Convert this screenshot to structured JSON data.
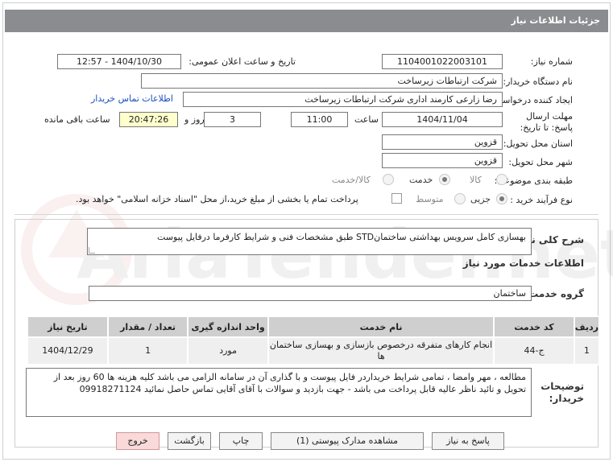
{
  "header": {
    "title": "جزئیات اطلاعات نیاز"
  },
  "fields": {
    "need_number_label": "شماره نیاز:",
    "need_number": "1104001022003101",
    "announce_label": "تاریخ و ساعت اعلان عمومی:",
    "announce_value": "1404/10/30 - 12:57",
    "buyer_org_label": "نام دستگاه خریدار:",
    "buyer_org": "شرکت ارتباطات زیرساخت",
    "requester_label": "ایجاد کننده درخواست:",
    "requester": "رضا زارعی کارمند اداری شرکت ارتباطات زیرساخت",
    "buyer_contact_link": "اطلاعات تماس خریدار",
    "deadline_label": "مهلت ارسال پاسخ: تا تاریخ:",
    "deadline_date": "1404/11/04",
    "time_label": "ساعت",
    "deadline_time": "11:00",
    "days_value": "3",
    "days_label": "روز و",
    "remaining_time": "20:47:26",
    "remaining_label": "ساعت باقی مانده",
    "province_label": "استان محل تحویل:",
    "province": "قزوین",
    "city_label": "شهر محل تحویل:",
    "city": "قزوین",
    "category_label": "طبقه بندی موضوعی:",
    "category_options": [
      "کالا",
      "خدمت",
      "کالا/خدمت"
    ],
    "category_selected": "خدمت",
    "process_label": "نوع فرآیند خرید :",
    "process_options": [
      "جزیی",
      "متوسط"
    ],
    "process_selected": "جزیی",
    "payment_note": "پرداخت تمام یا بخشی از مبلغ خرید،از محل \"اسناد خزانه اسلامی\" خواهد بود."
  },
  "description": {
    "label": "شرح کلی نیاز:",
    "text": "بهسازی  کامل سرویس بهداشتی ساختمانSTD  طبق مشخصات فنی و شرایط کارفرما درفایل پیوست"
  },
  "services": {
    "section_title": "اطلاعات خدمات مورد نیاز",
    "group_label": "گروه خدمت:",
    "group_value": "ساختمان",
    "table": {
      "headers": [
        "ردیف",
        "کد خدمت",
        "نام خدمت",
        "واحد اندازه گیری",
        "تعداد / مقدار",
        "تاریخ نیاز"
      ],
      "rows": [
        [
          "1",
          "ج-44",
          "انجام کارهای متفرقه درخصوص بازسازی و بهسازی ساختمان ها",
          "مورد",
          "1",
          "1404/12/29"
        ]
      ]
    }
  },
  "buyer_notes": {
    "label": "توضیحات خریدار:",
    "text": "مطالعه ، مهر وامضا ، تمامی شرایط خریداردر فایل پیوست و با گذاری آن در سامانه الزامی می باشد کلیه هزینه ها 60 روز بعد از تحویل و تائید ناظر عالیه قابل پرداخت می باشد - جهت بازدید و سوالات با آقای آقایی تماس حاصل نمائید 09918271124"
  },
  "buttons": {
    "reply": "پاسخ به نیاز",
    "view_docs": "مشاهده مدارک پیوستی (1)",
    "print": "چاپ",
    "back": "بازگشت",
    "exit": "خروج"
  },
  "watermark": {
    "text": "AriaTender.net"
  },
  "colors": {
    "titlebar": "#8b8c8f",
    "link": "#1a4fbf",
    "highlight": "#ffffcc",
    "exit_button": "#f9d9d9"
  }
}
